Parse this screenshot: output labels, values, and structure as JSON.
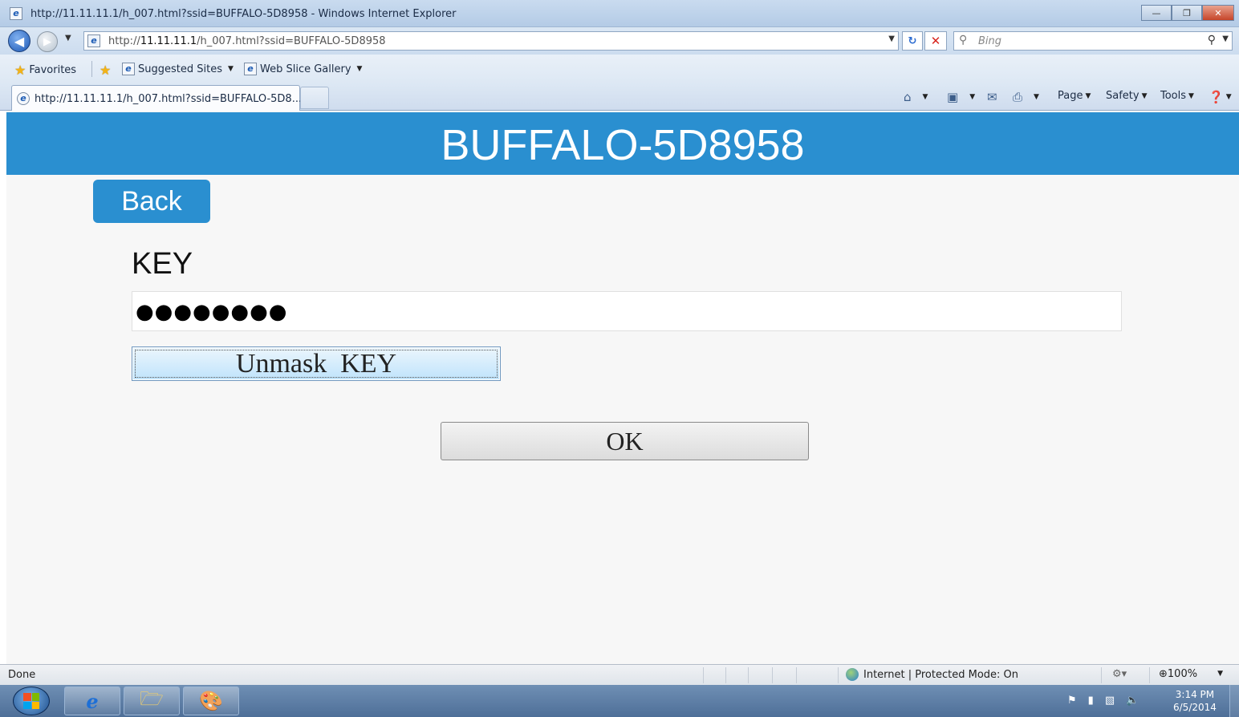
{
  "browser": {
    "window_title": "http://11.11.11.1/h_007.html?ssid=BUFFALO-5D8958 - Windows Internet Explorer",
    "address_prefix": "http://",
    "address_host": "11.11.11.1",
    "address_rest": "/h_007.html?ssid=BUFFALO-5D8958",
    "search_placeholder": "Bing",
    "favorites_label": "Favorites",
    "favorites_items": [
      "Suggested Sites",
      "Web Slice Gallery"
    ],
    "tab_title": "http://11.11.11.1/h_007.html?ssid=BUFFALO-5D8...",
    "command_items": [
      "Page",
      "Safety",
      "Tools"
    ]
  },
  "page": {
    "header_title": "BUFFALO-5D8958",
    "back_label": "Back",
    "key_label": "KEY",
    "key_value_masked": "●●●●●●●●",
    "unmask_label": "Unmask  KEY",
    "ok_label": "OK",
    "accent_color": "#2a8fd0"
  },
  "status": {
    "left_text": "Done",
    "zone_text": "Internet | Protected Mode: On",
    "zoom": "100%"
  },
  "taskbar": {
    "clock_time": "3:14 PM",
    "clock_date": "6/5/2014"
  }
}
